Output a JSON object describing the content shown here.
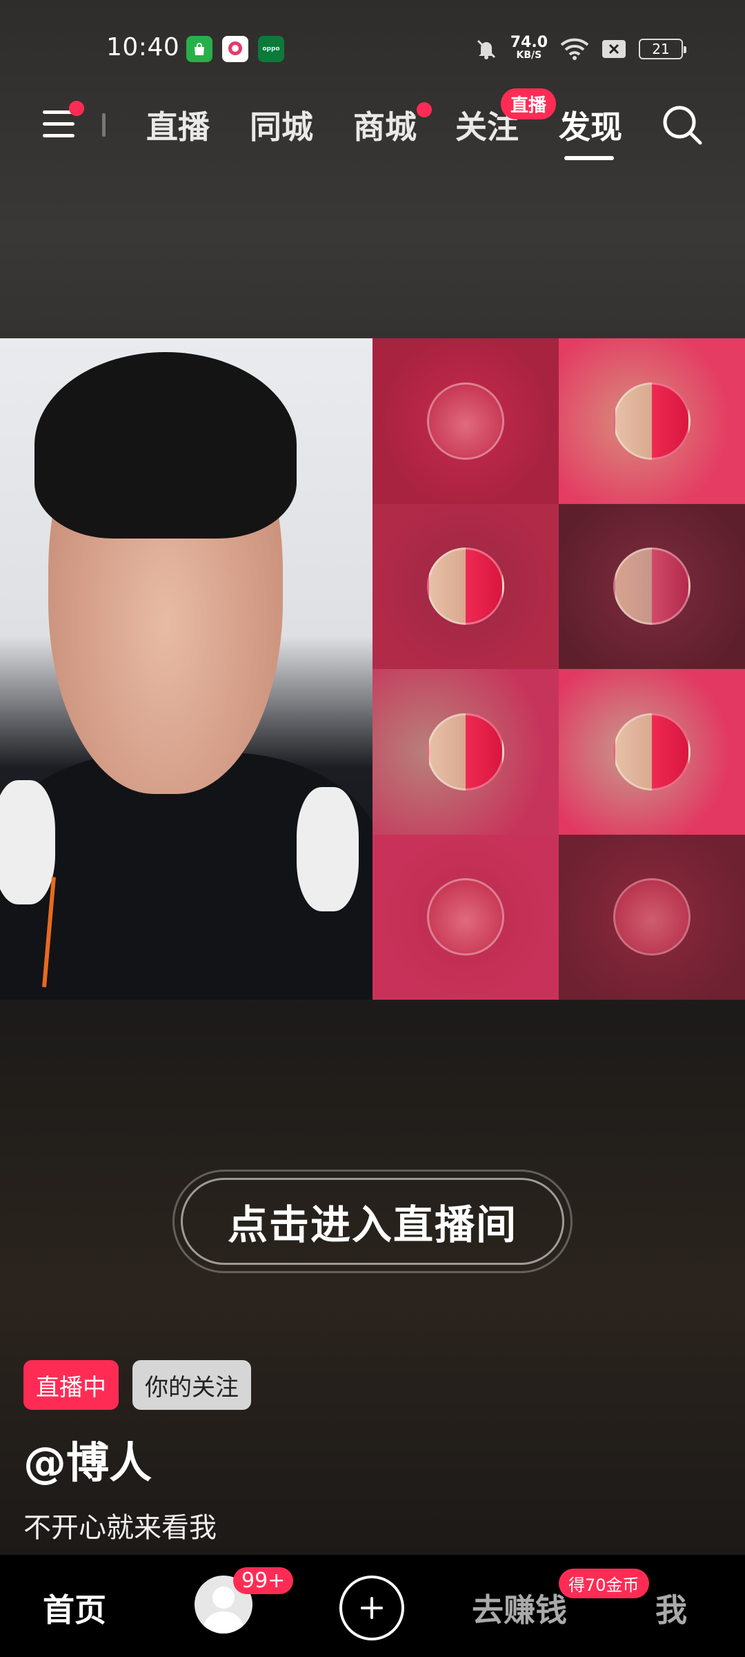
{
  "status_bar": {
    "time": "10:40",
    "apps": [
      "shopping-bag-app-icon",
      "chat-app-icon",
      "oppo-app-icon"
    ],
    "app3_label": "oppo",
    "net_speed_value": "74.0",
    "net_speed_unit": "KB/S",
    "battery": "21"
  },
  "top_nav": {
    "tabs": [
      {
        "label": "直播",
        "active": false
      },
      {
        "label": "同城",
        "active": false
      },
      {
        "label": "商城",
        "active": false,
        "dot": true
      },
      {
        "label": "关注",
        "active": false,
        "badge": "直播"
      },
      {
        "label": "发现",
        "active": true
      }
    ]
  },
  "live": {
    "enter_label": "点击进入直播间",
    "badge_live": "直播中",
    "badge_follow": "你的关注",
    "username": "@博人",
    "description": "不开心就来看我"
  },
  "bottom_nav": {
    "home": "首页",
    "avatar_badge": "99+",
    "earn": "去赚钱",
    "earn_badge": "得70金币",
    "me": "我"
  },
  "colors": {
    "accent": "#fe2c55"
  }
}
